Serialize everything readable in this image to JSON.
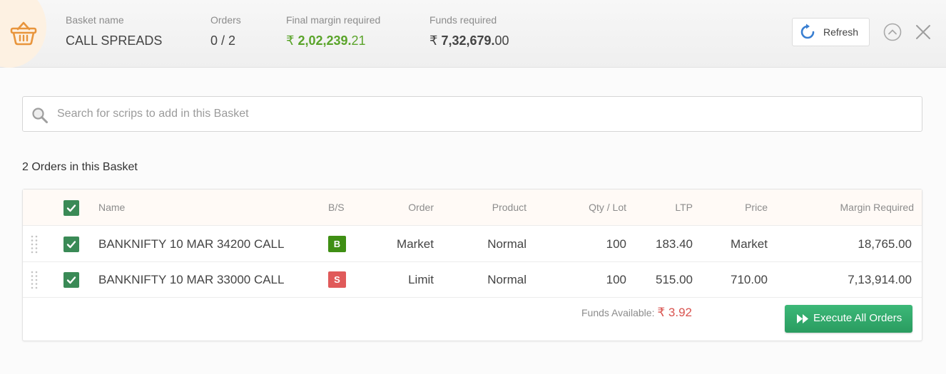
{
  "header": {
    "basket_label": "Basket name",
    "basket_name": "CALL SPREADS",
    "orders_label": "Orders",
    "orders_value": "0 / 2",
    "final_margin_label": "Final margin required",
    "final_margin_currency": "₹",
    "final_margin_main": "2,02,239.",
    "final_margin_dec": "21",
    "funds_label": "Funds required",
    "funds_currency": "₹",
    "funds_main": "7,32,679.",
    "funds_dec": "00",
    "refresh_label": "Refresh"
  },
  "search": {
    "placeholder": "Search for scrips to add in this Basket",
    "value": ""
  },
  "orders_count_text": "2 Orders in this Basket",
  "table": {
    "columns": {
      "name": "Name",
      "bs": "B/S",
      "order": "Order",
      "product": "Product",
      "qty": "Qty / Lot",
      "ltp": "LTP",
      "price": "Price",
      "margin": "Margin Required"
    },
    "rows": [
      {
        "name": "BANKNIFTY 10 MAR 34200 CALL",
        "bs": "B",
        "order": "Market",
        "product": "Normal",
        "qty": "100",
        "ltp": "183.40",
        "price": "Market",
        "margin": "18,765.00",
        "checked": true
      },
      {
        "name": "BANKNIFTY 10 MAR 33000 CALL",
        "bs": "S",
        "order": "Limit",
        "product": "Normal",
        "qty": "100",
        "ltp": "515.00",
        "price": "710.00",
        "margin": "7,13,914.00",
        "checked": true
      }
    ]
  },
  "footer": {
    "funds_label": "Funds Available:",
    "funds_value": "₹ 3.92",
    "execute_label": "Execute All Orders"
  },
  "colors": {
    "buy": "#3f8f14",
    "sell": "#e05a5a",
    "accent": "#387ed1",
    "execute": "#2fa86a",
    "checkbox": "#3a8a56"
  },
  "icons": [
    "basket-icon",
    "refresh-icon",
    "collapse-icon",
    "close-icon",
    "search-icon",
    "drag-handle-icon",
    "check-icon",
    "fast-forward-icon"
  ]
}
